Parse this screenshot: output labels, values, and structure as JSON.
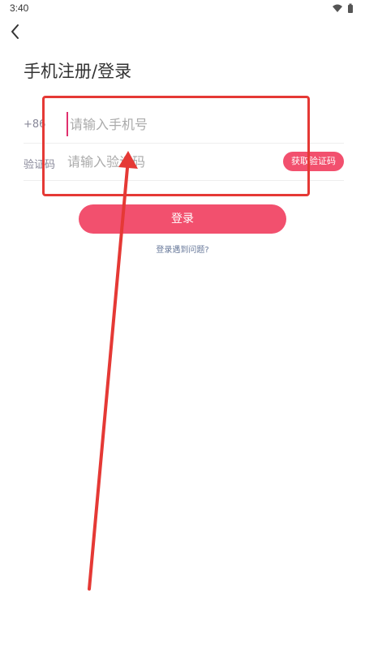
{
  "status_bar": {
    "time": "3:40",
    "icons": [
      "wifi-icon",
      "battery-icon"
    ]
  },
  "header": {
    "back_icon": "chevron-left-icon",
    "title": "手机注册/登录"
  },
  "form": {
    "phone": {
      "prefix": "+86",
      "placeholder": "请输入手机号",
      "value": ""
    },
    "code": {
      "label": "验证码",
      "placeholder": "请输入验证码",
      "value": "",
      "get_code_label": "获取验证码"
    }
  },
  "actions": {
    "login_label": "登录",
    "help_label": "登录遇到问题?"
  },
  "colors": {
    "accent": "#f2506e",
    "annotation": "#e53935"
  }
}
